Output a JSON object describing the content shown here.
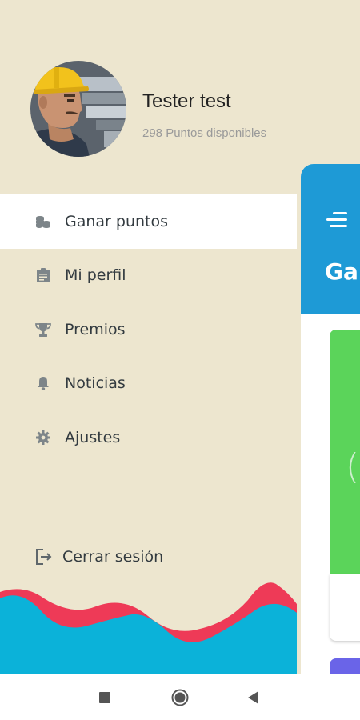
{
  "profile": {
    "name": "Tester test",
    "points": "298 Puntos disponibles",
    "avatar_icon": "worker-hardhat-avatar"
  },
  "menu": {
    "items": [
      {
        "label": "Ganar puntos",
        "icon": "coins-icon",
        "active": true
      },
      {
        "label": "Mi perfil",
        "icon": "clipboard-icon",
        "active": false
      },
      {
        "label": "Premios",
        "icon": "trophy-icon",
        "active": false
      },
      {
        "label": "Noticias",
        "icon": "bell-icon",
        "active": false
      },
      {
        "label": "Ajustes",
        "icon": "gear-icon",
        "active": false
      }
    ],
    "logout_label": "Cerrar sesión"
  },
  "app": {
    "title": "Gar",
    "card_text": "("
  },
  "colors": {
    "drawer_bg": "#ede6cf",
    "header_blue": "#1e9ad6",
    "card_green": "#5bd45a",
    "card_purple": "#6a64e8",
    "wave_red": "#ee3a57",
    "wave_cyan": "#0bb2d9"
  }
}
